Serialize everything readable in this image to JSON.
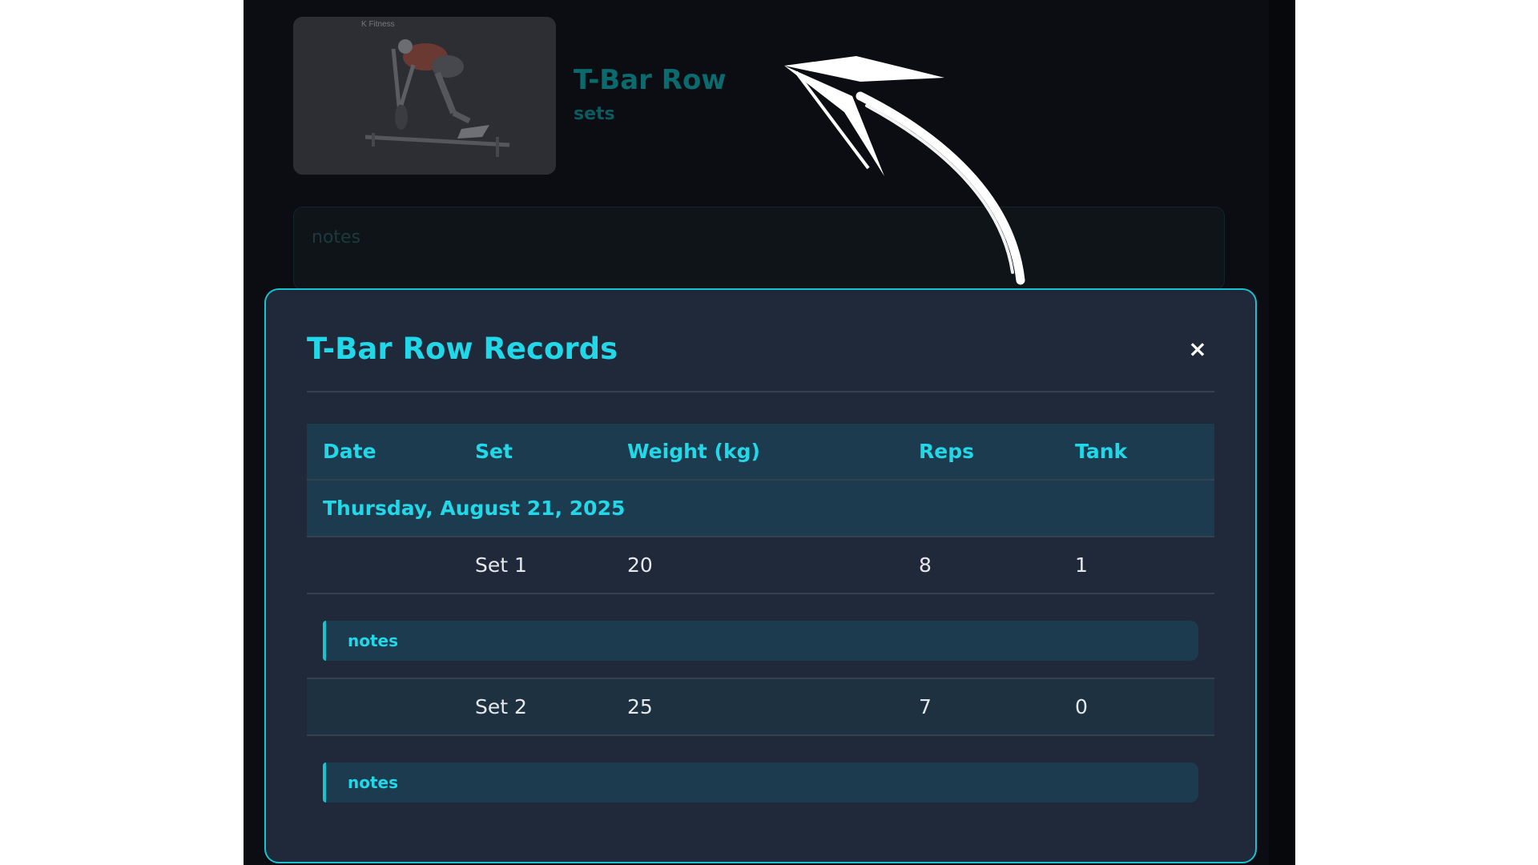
{
  "background": {
    "exercise_title": "T-Bar Row",
    "exercise_subtitle": "sets",
    "notes_placeholder": "notes"
  },
  "modal": {
    "title": "T-Bar Row Records",
    "close_icon": "×",
    "columns": [
      "Date",
      "Set",
      "Weight (kg)",
      "Reps",
      "Tank"
    ],
    "date_group": "Thursday, August 21, 2025",
    "sets": [
      {
        "set": "Set 1",
        "weight": "20",
        "reps": "8",
        "tank": "1",
        "note": "notes"
      },
      {
        "set": "Set 2",
        "weight": "25",
        "reps": "7",
        "tank": "0",
        "note": "notes"
      }
    ]
  },
  "colors": {
    "accent": "#22d8e8",
    "modal_bg": "#1f293a",
    "header_bg": "#1d3b4f",
    "page_bg": "#0b0d12"
  }
}
